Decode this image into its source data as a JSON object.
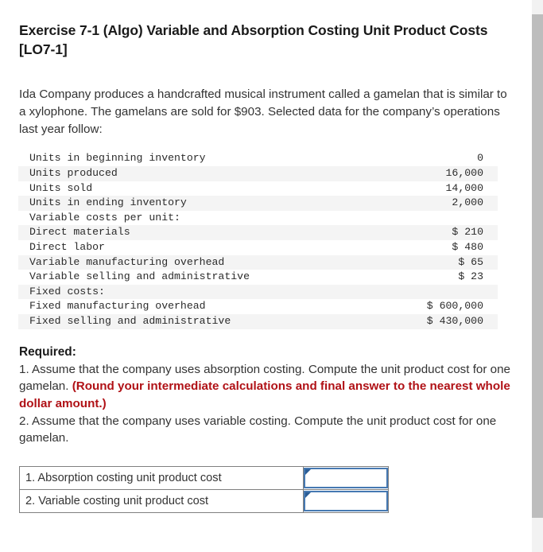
{
  "exercise": {
    "title": "Exercise 7-1 (Algo) Variable and Absorption Costing Unit Product Costs [LO7-1]",
    "intro": "Ida Company produces a handcrafted musical instrument called a gamelan that is similar to a xylophone. The gamelans are sold for $903. Selected data for the company’s operations last year follow:"
  },
  "data_table": {
    "rows": [
      {
        "label": "Units in beginning inventory",
        "value": "0",
        "indent": 0,
        "stripe": false
      },
      {
        "label": "Units produced",
        "value": "16,000",
        "indent": 0,
        "stripe": true
      },
      {
        "label": "Units sold",
        "value": "14,000",
        "indent": 0,
        "stripe": false
      },
      {
        "label": "Units in ending inventory",
        "value": "2,000",
        "indent": 0,
        "stripe": true
      },
      {
        "label": "Variable costs per unit:",
        "value": "",
        "indent": 0,
        "stripe": false
      },
      {
        "label": "Direct materials",
        "value": "$ 210",
        "indent": 1,
        "stripe": true
      },
      {
        "label": "Direct labor",
        "value": "$ 480",
        "indent": 1,
        "stripe": false
      },
      {
        "label": "Variable manufacturing overhead",
        "value": "$ 65",
        "indent": 1,
        "stripe": true
      },
      {
        "label": "Variable selling and administrative",
        "value": "$ 23",
        "indent": 1,
        "stripe": false
      },
      {
        "label": "Fixed costs:",
        "value": "",
        "indent": 0,
        "stripe": true
      },
      {
        "label": "Fixed manufacturing overhead",
        "value": "$ 600,000",
        "indent": 1,
        "stripe": false
      },
      {
        "label": "Fixed selling and administrative",
        "value": "$ 430,000",
        "indent": 1,
        "stripe": true
      }
    ]
  },
  "required": {
    "heading": "Required:",
    "item1_part1": "1. Assume that the company uses absorption costing. Compute the unit product cost for one gamelan. ",
    "item1_emphasis": "(Round your intermediate calculations and final answer to the nearest whole dollar amount.)",
    "item2": "2. Assume that the company uses variable costing. Compute the unit product cost for one gamelan."
  },
  "answer_table": {
    "rows": [
      {
        "label": "1. Absorption costing unit product cost",
        "value": "",
        "placeholder": ""
      },
      {
        "label": "2. Variable costing unit product cost",
        "value": "",
        "placeholder": ""
      }
    ]
  },
  "colors": {
    "emphasis_red": "#b01116",
    "input_border_blue": "#4679b2",
    "marker_blue": "#2b5d96",
    "stripe_gray": "#f4f4f4",
    "scrollbar_thumb": "#bdbdbd"
  }
}
